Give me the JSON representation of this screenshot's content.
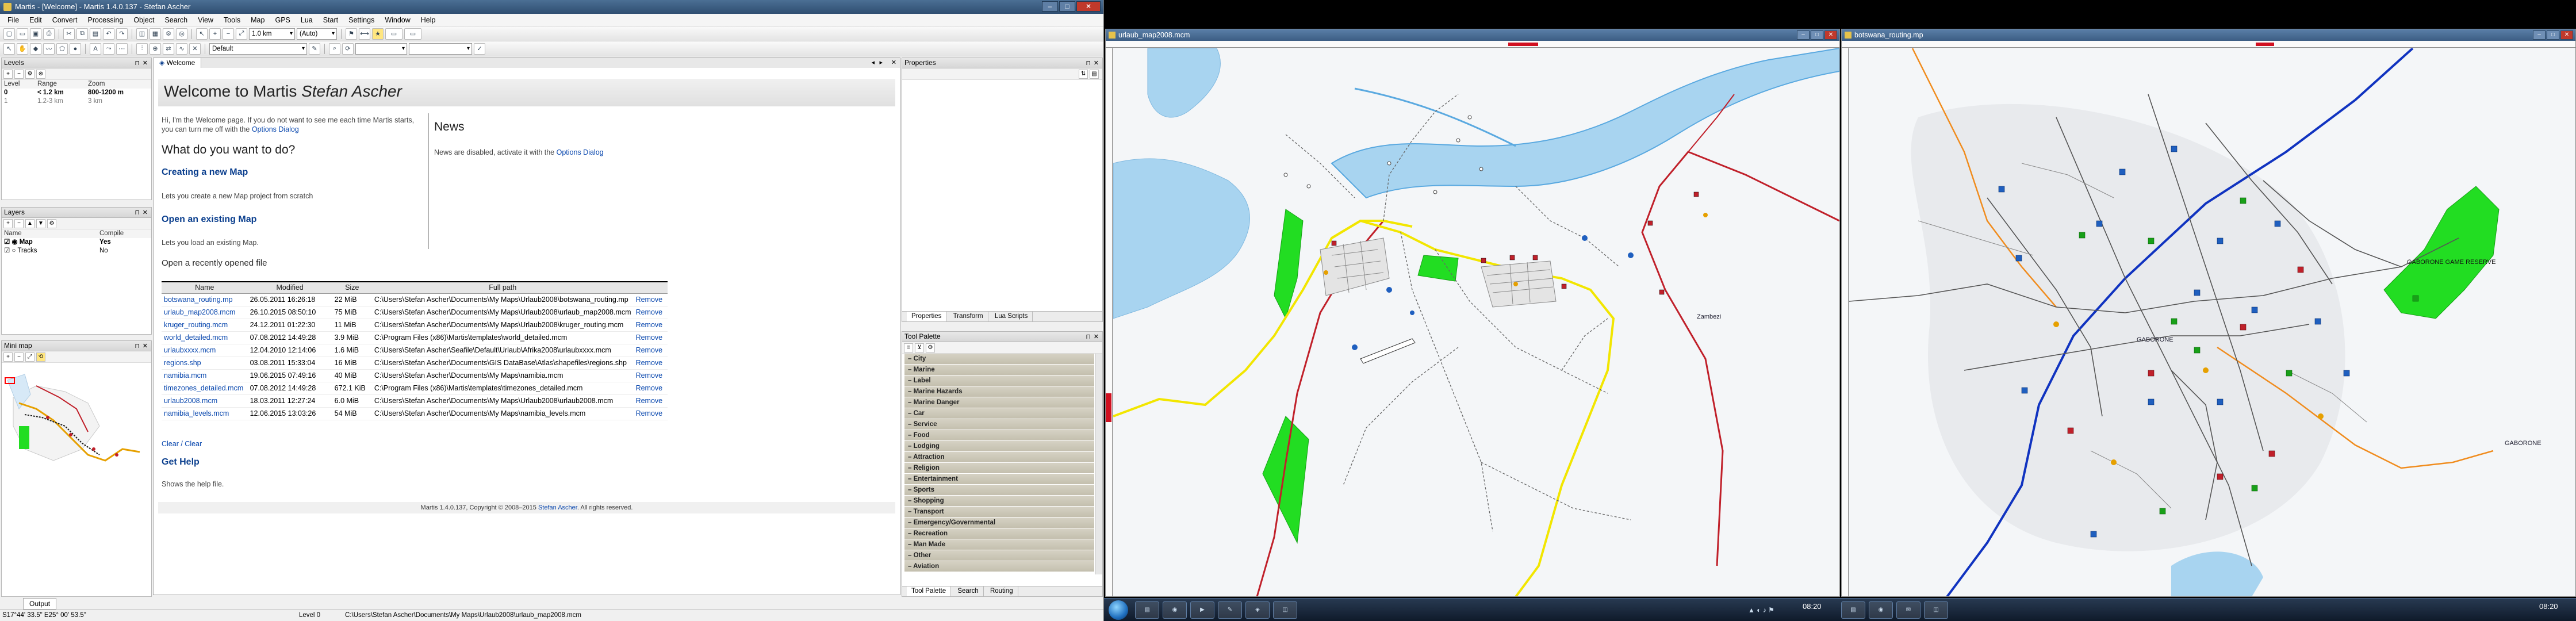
{
  "app": {
    "title": "Martis - [Welcome] - Martis 1.4.0.137 - Stefan Ascher",
    "menu": [
      "File",
      "Edit",
      "Convert",
      "Processing",
      "Object",
      "Search",
      "View",
      "Tools",
      "Map",
      "GPS",
      "Lua",
      "Start",
      "Settings",
      "Window",
      "Help"
    ],
    "toolbar": {
      "zoom_value": "1.0 km",
      "scale_value": "(Auto)",
      "style_value": "Default"
    }
  },
  "levels_panel": {
    "title": "Levels",
    "columns": [
      "Level",
      "Range",
      "Zoom"
    ],
    "rows": [
      {
        "level": "0",
        "range": "< 1.2 km",
        "zoom": "800-1200 m"
      },
      {
        "level": "1",
        "range": "1.2-3 km",
        "zoom": "3 km"
      }
    ]
  },
  "layers_panel": {
    "title": "Layers",
    "columns": [
      "Name",
      "Compile"
    ],
    "rows": [
      {
        "name": "Map",
        "compile": "Yes"
      },
      {
        "name": "Tracks",
        "compile": "No"
      }
    ]
  },
  "minimap_panel": {
    "title": "Mini map"
  },
  "output_tab": "Output",
  "welcome": {
    "tab": "Welcome",
    "title_prefix": "Welcome to Martis ",
    "title_name": "Stefan Ascher",
    "intro_1": "Hi, I'm the Welcome page. If you do not want to see me each time Martis starts,",
    "intro_2": "you can turn me off with the ",
    "intro_link": "Options Dialog",
    "what_heading": "What do you want to do?",
    "create_link": "Creating a new Map",
    "create_desc": "Lets you create a new Map project from scratch",
    "open_link": "Open an existing Map",
    "open_desc": "Lets you load an existing Map.",
    "recent_heading": "Open a recently opened file",
    "recent_columns": [
      "Name",
      "Modified",
      "Size",
      "Full path",
      ""
    ],
    "recent_files": [
      {
        "name": "botswana_routing.mp",
        "modified": "26.05.2011 16:26:18",
        "size": "22 MiB",
        "path": "C:\\Users\\Stefan Ascher\\Documents\\My Maps\\Urlaub2008\\botswana_routing.mp",
        "action": "Remove"
      },
      {
        "name": "urlaub_map2008.mcm",
        "modified": "26.10.2015 08:50:10",
        "size": "75 MiB",
        "path": "C:\\Users\\Stefan Ascher\\Documents\\My Maps\\Urlaub2008\\urlaub_map2008.mcm",
        "action": "Remove"
      },
      {
        "name": "kruger_routing.mcm",
        "modified": "24.12.2011 01:22:30",
        "size": "11 MiB",
        "path": "C:\\Users\\Stefan Ascher\\Documents\\My Maps\\Urlaub2008\\kruger_routing.mcm",
        "action": "Remove"
      },
      {
        "name": "world_detailed.mcm",
        "modified": "07.08.2012 14:49:28",
        "size": "3.9 MiB",
        "path": "C:\\Program Files (x86)\\Martis\\templates\\world_detailed.mcm",
        "action": "Remove"
      },
      {
        "name": "urlaubxxxx.mcm",
        "modified": "12.04.2010 12:14:06",
        "size": "1.6 MiB",
        "path": "C:\\Users\\Stefan Ascher\\Seafile\\Default\\Urlaub\\Afrika2008\\urlaubxxxx.mcm",
        "action": "Remove"
      },
      {
        "name": "regions.shp",
        "modified": "03.08.2011 15:33:04",
        "size": "16 MiB",
        "path": "C:\\Users\\Stefan Ascher\\Documents\\GIS DataBase\\Atlas\\shapefiles\\regions.shp",
        "action": "Remove"
      },
      {
        "name": "namibia.mcm",
        "modified": "19.06.2015 07:49:16",
        "size": "40 MiB",
        "path": "C:\\Users\\Stefan Ascher\\Documents\\My Maps\\namibia.mcm",
        "action": "Remove"
      },
      {
        "name": "timezones_detailed.mcm",
        "modified": "07.08.2012 14:49:28",
        "size": "672.1 KiB",
        "path": "C:\\Program Files (x86)\\Martis\\templates\\timezones_detailed.mcm",
        "action": "Remove"
      },
      {
        "name": "urlaub2008.mcm",
        "modified": "18.03.2011 12:27:24",
        "size": "6.0 MiB",
        "path": "C:\\Users\\Stefan Ascher\\Documents\\My Maps\\Urlaub2008\\urlaub2008.mcm",
        "action": "Remove"
      },
      {
        "name": "namibia_levels.mcm",
        "modified": "12.06.2015 13:03:26",
        "size": "54 MiB",
        "path": "C:\\Users\\Stefan Ascher\\Documents\\My Maps\\namibia_levels.mcm",
        "action": "Remove"
      }
    ],
    "clear_link": "Clear / Clear",
    "help_heading": "Get Help",
    "help_desc": "Shows the help file.",
    "news_heading": "News",
    "news_text": "News are disabled, activate it with the ",
    "news_link": "Options Dialog",
    "footer": "Martis 1.4.0.137, Copyright © 2008–2015 ",
    "footer_link": "Stefan Ascher",
    "footer_end": ". All rights reserved."
  },
  "properties_panel": {
    "title": "Properties",
    "tabs": [
      "Properties",
      "Transform",
      "Lua Scripts"
    ]
  },
  "tool_palette": {
    "title": "Tool Palette",
    "categories": [
      "City",
      "Marine",
      "Label",
      "Marine Hazards",
      "Marine Danger",
      "Car",
      "Service",
      "Food",
      "Lodging",
      "Attraction",
      "Religion",
      "Entertainment",
      "Sports",
      "Shopping",
      "Transport",
      "Emergency/Governmental",
      "Recreation",
      "Man Made",
      "Other",
      "Aviation"
    ],
    "bottom_tabs": [
      "Tool Palette",
      "Search",
      "Routing"
    ]
  },
  "statusbar": {
    "coords": "S17°44' 33.5\" E25° 00' 53.5\"",
    "level": "Level 0",
    "path": "C:\\Users\\Stefan Ascher\\Documents\\My Maps\\Urlaub2008\\urlaub_map2008.mcm"
  },
  "map_left": {
    "title": "urlaub_map2008.mcm",
    "place_label": "Zambezi"
  },
  "map_right": {
    "title": "botswana_routing.mp",
    "labels": [
      "GABORONE",
      "GABORONE",
      "GABORONE GAME RESERVE"
    ]
  },
  "taskbar": {
    "clock": "08:20"
  },
  "colors": {
    "water": "#a8d4f0",
    "river": "#5aa9e0",
    "park": "#22dd22",
    "road_red": "#c0202a",
    "road_yellow": "#f2e600",
    "road_blue": "#1033c0",
    "road_orange": "#f08c1e",
    "map_bg": "#f4f6f8"
  }
}
